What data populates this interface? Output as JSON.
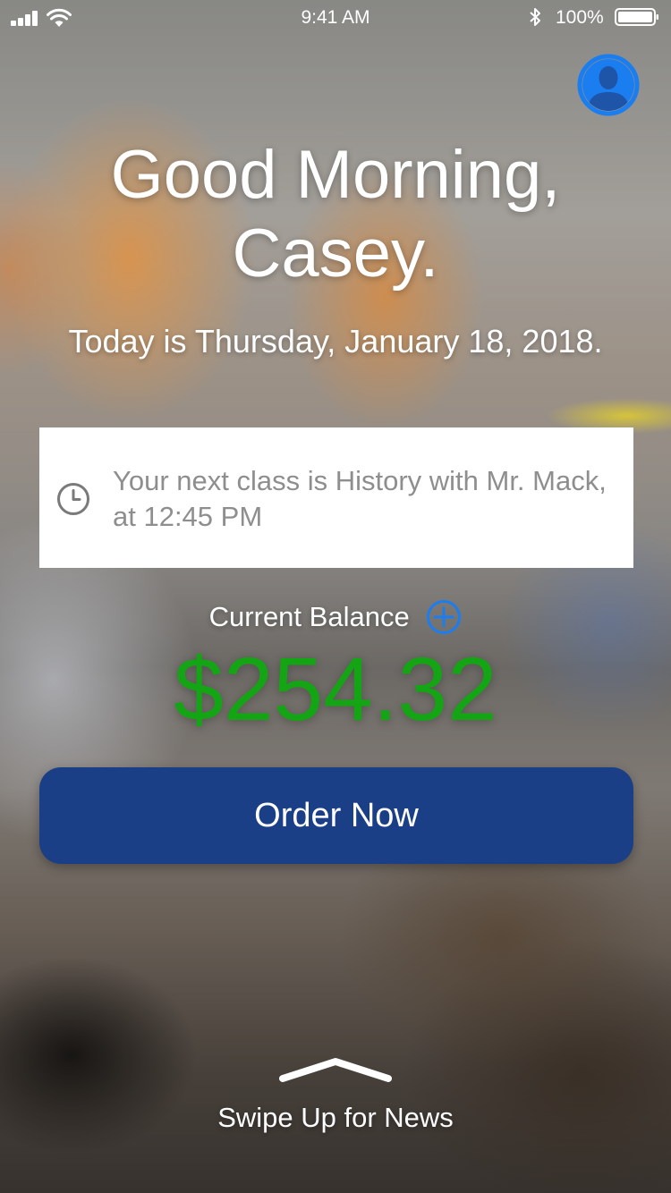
{
  "status_bar": {
    "time": "9:41 AM",
    "battery_percent": "100%",
    "icons": [
      "signal-icon",
      "wifi-icon",
      "bluetooth-icon",
      "battery-icon"
    ]
  },
  "profile": {
    "icon": "user-avatar-icon",
    "color": "#1a7df0"
  },
  "greeting": {
    "line1": "Good Morning,",
    "line2": "Casey."
  },
  "date_text": "Today is Thursday, January 18, 2018.",
  "next_class": {
    "icon": "clock-icon",
    "text": "Your next class is History with Mr. Mack, at 12:45 PM"
  },
  "balance": {
    "label": "Current Balance",
    "add_icon": "plus-circle-icon",
    "amount": "$254.32",
    "amount_color": "#14a514"
  },
  "order_button": {
    "label": "Order Now",
    "color": "#1a3f86"
  },
  "swipe": {
    "icon": "chevron-up-icon",
    "label": "Swipe Up for News"
  }
}
